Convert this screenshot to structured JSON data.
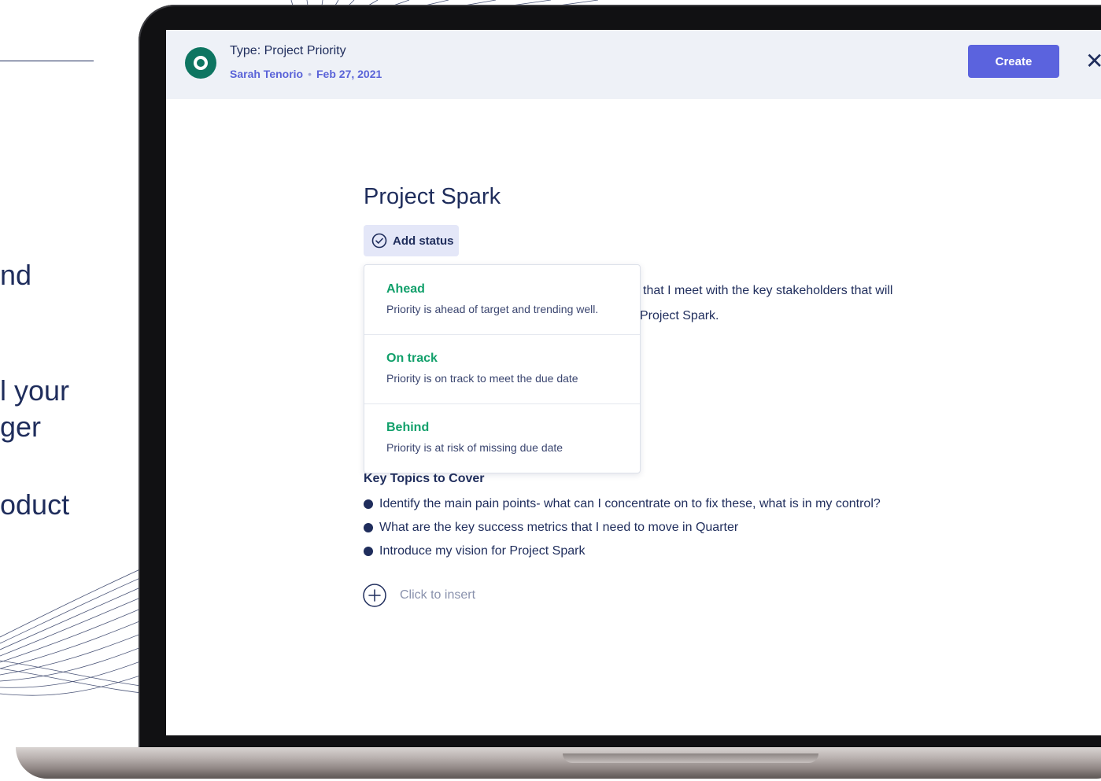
{
  "background": {
    "text_fragments": [
      "nd",
      "l your",
      "ger",
      "oduct"
    ]
  },
  "header": {
    "type_label": "Type: Project Priority",
    "author": "Sarah Tenorio",
    "separator": "•",
    "date": "Feb 27, 2021",
    "create_label": "Create",
    "close_glyph": "✕",
    "type_icon": "target-icon",
    "accent": "#5b63de",
    "icon_color": "#0e7561"
  },
  "document": {
    "title": "Project Spark",
    "add_status_label": "Add status",
    "status_icon": "check-circle-icon",
    "intro_line1": "that I meet with the key stakeholders that will",
    "intro_line2": "Project Spark.",
    "section_heading": "Key Topics to Cover",
    "bullets": [
      "Identify the main pain points- what can I concentrate on to fix these, what is in my control?",
      "What are the key success metrics that I need to move in Quarter",
      "Introduce my vision for Project Spark"
    ],
    "insert_label": "Click to insert",
    "insert_icon": "plus-circle-icon"
  },
  "status_menu": {
    "options": [
      {
        "name": "Ahead",
        "description": "Priority is ahead of target and trending well."
      },
      {
        "name": "On track",
        "description": "Priority is on track to meet the due date"
      },
      {
        "name": "Behind",
        "description": "Priority is at risk of missing due date"
      }
    ],
    "option_color": "#12a06b"
  }
}
